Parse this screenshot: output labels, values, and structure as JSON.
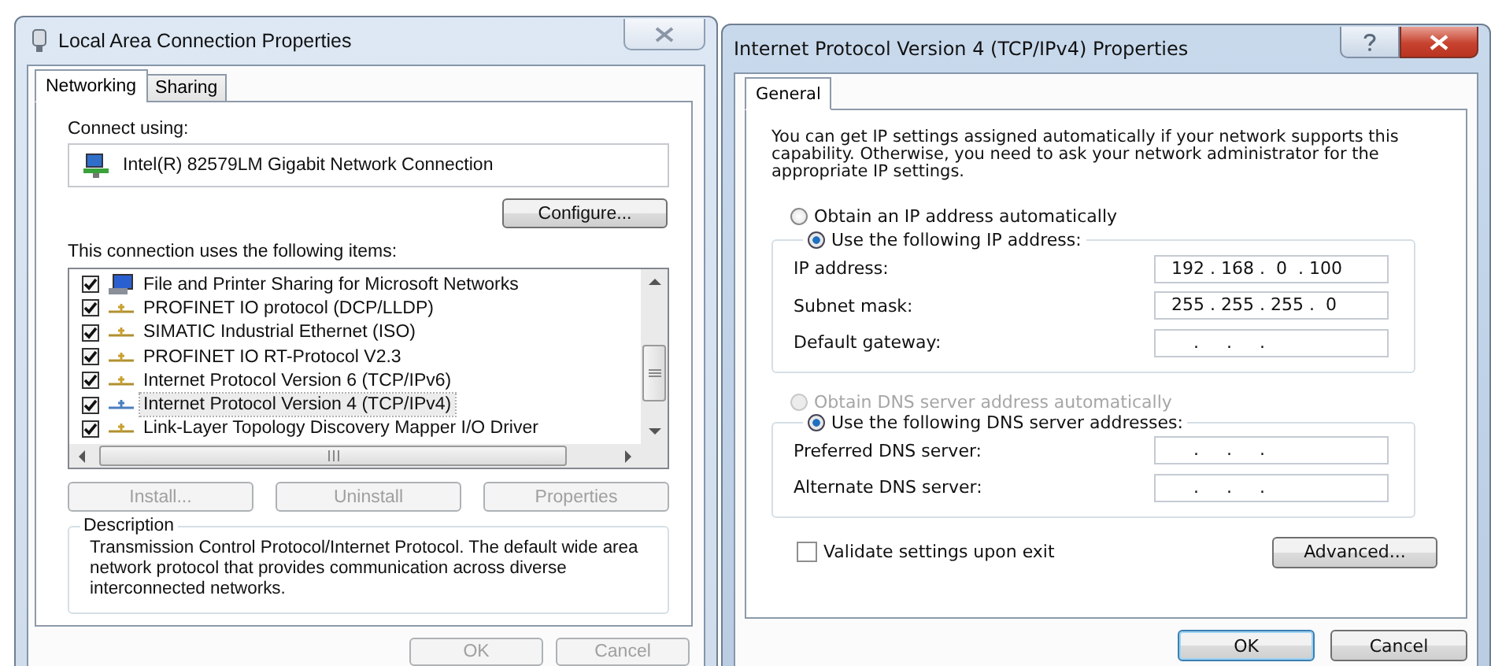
{
  "left_window": {
    "title": "Local Area Connection Properties",
    "tabs": [
      {
        "label": "Networking",
        "selected": true
      },
      {
        "label": "Sharing",
        "selected": false
      }
    ],
    "connect_using_label": "Connect using:",
    "adapter": "Intel(R) 82579LM Gigabit Network Connection",
    "configure_button": "Configure...",
    "items_label": "This connection uses the following items:",
    "items": [
      {
        "label": "File and Printer Sharing for Microsoft Networks",
        "checked": true,
        "kind": "service",
        "selected": false
      },
      {
        "label": "PROFINET IO protocol (DCP/LLDP)",
        "checked": true,
        "kind": "protocol",
        "selected": false
      },
      {
        "label": "SIMATIC Industrial Ethernet (ISO)",
        "checked": true,
        "kind": "protocol",
        "selected": false
      },
      {
        "label": "PROFINET IO RT-Protocol V2.3",
        "checked": true,
        "kind": "protocol",
        "selected": false
      },
      {
        "label": "Internet Protocol Version 6 (TCP/IPv6)",
        "checked": true,
        "kind": "protocol",
        "selected": false
      },
      {
        "label": "Internet Protocol Version 4 (TCP/IPv4)",
        "checked": true,
        "kind": "protocol",
        "selected": true
      },
      {
        "label": "Link-Layer Topology Discovery Mapper I/O Driver",
        "checked": true,
        "kind": "protocol",
        "selected": false
      }
    ],
    "item_buttons": [
      {
        "label": "Install...",
        "disabled": true
      },
      {
        "label": "Uninstall",
        "disabled": true
      },
      {
        "label": "Properties",
        "disabled": true
      }
    ],
    "description_title": "Description",
    "description": "Transmission Control Protocol/Internet Protocol. The default wide area network protocol that provides communication across diverse interconnected networks.",
    "footer_buttons": [
      {
        "label": "OK",
        "disabled": true
      },
      {
        "label": "Cancel",
        "disabled": true
      }
    ]
  },
  "right_window": {
    "title": "Internet Protocol Version 4 (TCP/IPv4) Properties",
    "tabs": [
      {
        "label": "General",
        "selected": true
      }
    ],
    "intro": "You can get IP settings assigned automatically if your network supports this capability. Otherwise, you need to ask your network administrator for the appropriate IP settings.",
    "ip_options": [
      {
        "label": "Obtain an IP address automatically",
        "selected": false,
        "disabled": false
      },
      {
        "label": "Use the following IP address:",
        "selected": true,
        "disabled": false
      }
    ],
    "ip_fields": [
      {
        "label": "IP address:",
        "value": "192 . 168 .  0  . 100"
      },
      {
        "label": "Subnet mask:",
        "value": "255 . 255 . 255 .  0"
      },
      {
        "label": "Default gateway:",
        "value": "    .     .     ."
      }
    ],
    "dns_options": [
      {
        "label": "Obtain DNS server address automatically",
        "selected": false,
        "disabled": true
      },
      {
        "label": "Use the following DNS server addresses:",
        "selected": true,
        "disabled": false
      }
    ],
    "dns_fields": [
      {
        "label": "Preferred DNS server:",
        "value": "    .     .     ."
      },
      {
        "label": "Alternate DNS server:",
        "value": "    .     .     ."
      }
    ],
    "validate": {
      "label": "Validate settings upon exit",
      "checked": false
    },
    "advanced_button": "Advanced...",
    "footer_buttons": [
      {
        "label": "OK",
        "default": true
      },
      {
        "label": "Cancel",
        "default": false
      }
    ]
  }
}
